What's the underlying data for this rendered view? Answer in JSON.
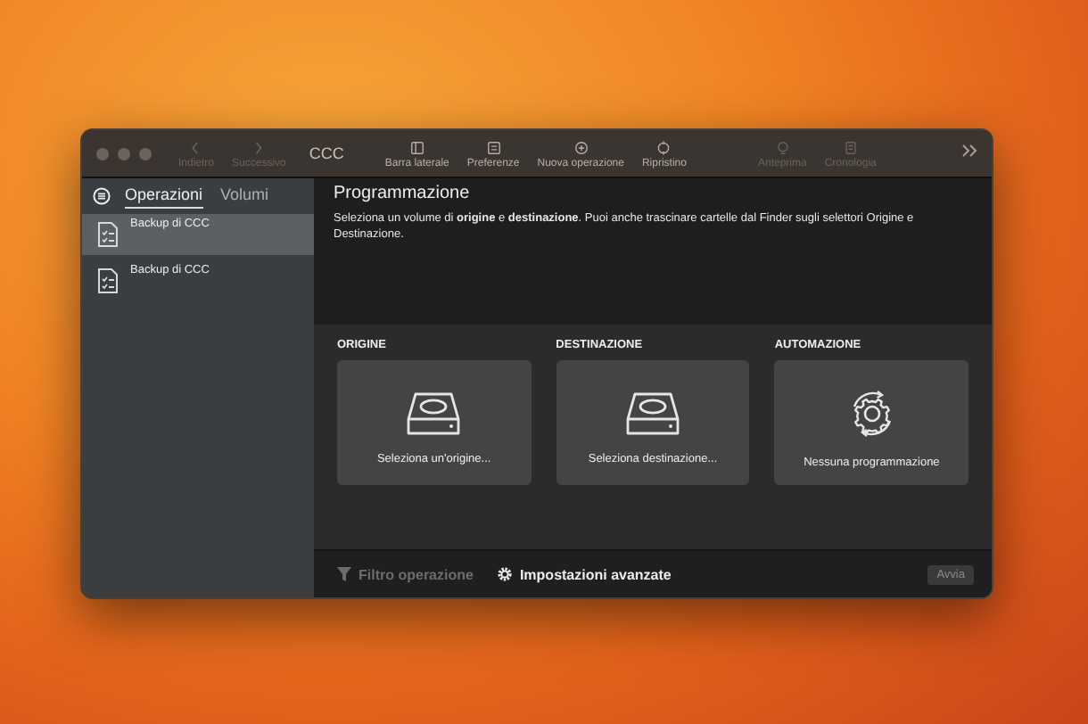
{
  "window": {
    "title": "CCC"
  },
  "toolbar": [
    {
      "label": "Indietro",
      "kind": "back",
      "disabled": true
    },
    {
      "label": "Successivo",
      "kind": "forward",
      "disabled": true
    },
    {
      "label": "Barra laterale",
      "kind": "sidebar",
      "disabled": false
    },
    {
      "label": "Preferenze",
      "kind": "prefs",
      "disabled": false
    },
    {
      "label": "Nuova operazione",
      "kind": "new",
      "disabled": false
    },
    {
      "label": "Ripristino",
      "kind": "restore",
      "disabled": false
    },
    {
      "label": "Anteprima",
      "kind": "preview",
      "disabled": true
    },
    {
      "label": "Cronologia",
      "kind": "history",
      "disabled": true
    }
  ],
  "sidebar": {
    "tabs": [
      {
        "label": "Operazioni",
        "selected": true
      },
      {
        "label": "Volumi",
        "selected": false
      }
    ],
    "items": [
      {
        "label": "Backup di CCC",
        "selected": true
      },
      {
        "label": "Backup di CCC",
        "selected": false
      }
    ]
  },
  "main": {
    "title": "Programmazione",
    "description": "Seleziona un volume di **origine** e **destinazione**. Puoi anche trascinare cartelle dal Finder sugli selettori Origine e Destinazione.",
    "sections": [
      {
        "heading": "ORIGINE",
        "kind": "disk",
        "label": "Seleziona un'origine..."
      },
      {
        "heading": "DESTINAZIONE",
        "kind": "disk",
        "label": "Seleziona destinazione..."
      },
      {
        "heading": "AUTOMAZIONE",
        "kind": "schedule",
        "label": "Nessuna programmazione"
      }
    ]
  },
  "bottom_bar": {
    "filter": {
      "label": "Filtro operazione",
      "disabled": true
    },
    "advanced": {
      "label": "Impostazioni avanzate",
      "disabled": false
    },
    "start_button": {
      "label": "Avvia",
      "disabled": true
    }
  }
}
